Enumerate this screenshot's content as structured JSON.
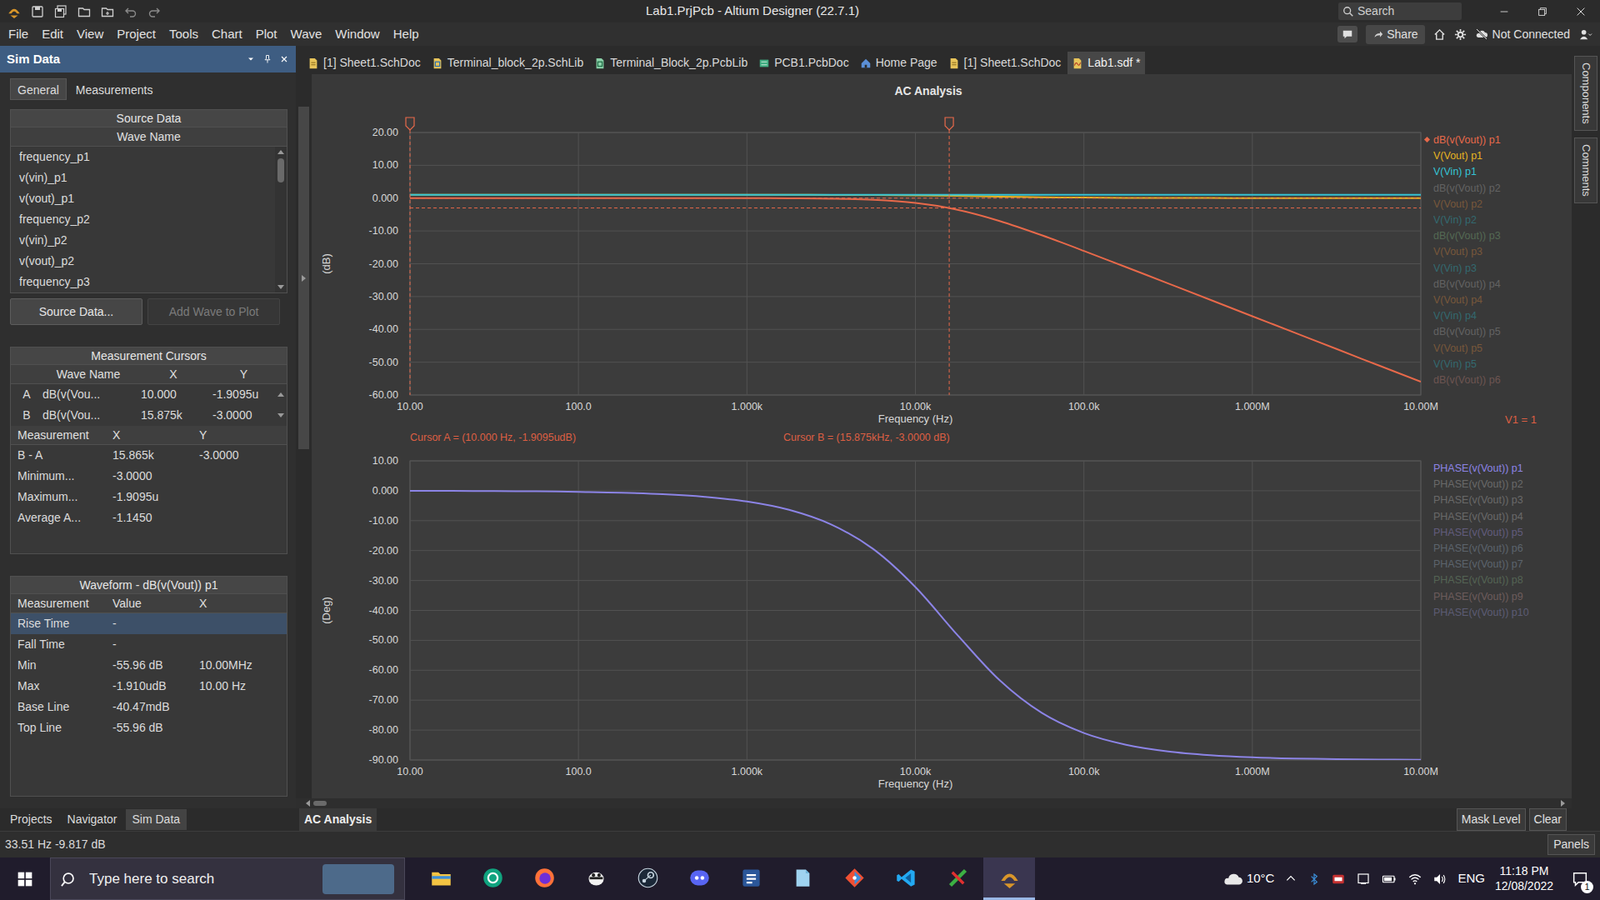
{
  "window": {
    "title": "Lab1.PrjPcb - Altium Designer (22.7.1)",
    "search_placeholder": "Search"
  },
  "menu": {
    "items": [
      "File",
      "Edit",
      "View",
      "Project",
      "Tools",
      "Chart",
      "Plot",
      "Wave",
      "Window",
      "Help"
    ],
    "share": "Share",
    "connection": "Not Connected"
  },
  "panel": {
    "title": "Sim Data",
    "tabs": [
      {
        "label": "General",
        "selected": true
      },
      {
        "label": "Measurements",
        "selected": false
      }
    ],
    "source": {
      "title": "Source Data",
      "column": "Wave Name",
      "items": [
        "frequency_p1",
        "v(vin)_p1",
        "v(vout)_p1",
        "frequency_p2",
        "v(vin)_p2",
        "v(vout)_p2",
        "frequency_p3"
      ],
      "scroll_level": 0.2
    },
    "buttons": [
      {
        "label": "Source Data...",
        "disabled": false
      },
      {
        "label": "Add Wave to Plot",
        "disabled": true
      }
    ],
    "cursors": {
      "title": "Measurement Cursors",
      "columns": [
        "Wave Name",
        "X",
        "Y"
      ],
      "rows": [
        {
          "id": "A",
          "cells": [
            "dB(v(Vou...",
            "10.000",
            "-1.9095u"
          ]
        },
        {
          "id": "B",
          "cells": [
            "dB(v(Vou...",
            "15.875k",
            "-3.0000"
          ]
        }
      ]
    },
    "measurements": {
      "columns": [
        "Measurement",
        "X",
        "Y"
      ],
      "rows": [
        [
          "B - A",
          "15.865k",
          "-3.0000"
        ],
        [
          "Minimum...",
          "-3.0000",
          ""
        ],
        [
          "Maximum...",
          "-1.9095u",
          ""
        ],
        [
          "Average A...",
          "-1.1450",
          ""
        ]
      ]
    },
    "waveform": {
      "title": "Waveform - dB(v(Vout)) p1",
      "columns": [
        "Measurement",
        "Value",
        "X"
      ],
      "rows": [
        {
          "cells": [
            "Rise Time",
            "-",
            ""
          ],
          "selected": true
        },
        {
          "cells": [
            "Fall Time",
            "-",
            ""
          ],
          "selected": false
        },
        {
          "cells": [
            "Min",
            "-55.96 dB",
            "10.00MHz"
          ],
          "selected": false
        },
        {
          "cells": [
            "Max",
            "-1.910udB",
            "10.00 Hz"
          ],
          "selected": false
        },
        {
          "cells": [
            "Base Line",
            "-40.47mdB",
            ""
          ],
          "selected": false
        },
        {
          "cells": [
            "Top Line",
            "-55.96 dB",
            ""
          ],
          "selected": false
        }
      ]
    },
    "bottom_tabs": [
      {
        "label": "Projects",
        "selected": false
      },
      {
        "label": "Navigator",
        "selected": false
      },
      {
        "label": "Sim Data",
        "selected": true
      }
    ]
  },
  "doc_tabs": [
    {
      "label": "[1] Sheet1.SchDoc",
      "kind": "sch",
      "selected": false
    },
    {
      "label": "Terminal_block_2p.SchLib",
      "kind": "schlib",
      "selected": false
    },
    {
      "label": "Terminal_Block_2p.PcbLib",
      "kind": "pcblib",
      "selected": false
    },
    {
      "label": "PCB1.PcbDoc",
      "kind": "pcb",
      "selected": false
    },
    {
      "label": "Home Page",
      "kind": "home",
      "selected": false
    },
    {
      "label": "[1] Sheet1.SchDoc",
      "kind": "sch",
      "selected": false
    },
    {
      "label": "Lab1.sdf *",
      "kind": "sdf",
      "selected": true
    }
  ],
  "chart": {
    "title": "AC Analysis",
    "frequencies": [
      10,
      17.78,
      31.62,
      56.23,
      100,
      177.8,
      316.2,
      562.3,
      1000,
      1778,
      3162,
      5623,
      10000,
      17783,
      31623,
      56234,
      100000,
      177828,
      316228,
      562341,
      1000000,
      1778279,
      3162278,
      5623413,
      10000000
    ],
    "top": {
      "y_label": "(dB)",
      "x_label": "Frequency (Hz)",
      "y_max": 20,
      "y_min": -60,
      "x_ticks": [
        "10.00",
        "100.0",
        "1.000k",
        "10.00k",
        "100.0k",
        "1.000M",
        "10.00M"
      ],
      "y_ticks": [
        "20.00",
        "10.00",
        "0.000",
        "-10.00",
        "-20.00",
        "-30.00",
        "-40.00",
        "-50.00",
        "-60.00"
      ],
      "note": "V1 = 1",
      "legend": [
        {
          "label": "dB(v(Vout)) p1",
          "color": "#e8694a",
          "dimmed": false,
          "selected": true,
          "values": [
            -1.9e-06,
            -5e-06,
            -1.7e-05,
            -5.4e-05,
            -0.00017,
            -0.00054,
            -0.0017,
            -0.0055,
            -0.017,
            -0.054,
            -0.169,
            -0.513,
            -1.451,
            -3.531,
            -6.962,
            -11.32,
            -16.09,
            -21.02,
            -26.0,
            -30.99,
            -35.99,
            -40.99,
            -45.99,
            -50.99,
            -55.96
          ]
        },
        {
          "label": "V(Vout) p1",
          "color": "#e6b422",
          "dimmed": false,
          "selected": false,
          "values": [
            1,
            1,
            1,
            1,
            1,
            1,
            1,
            0.999,
            0.998,
            0.994,
            0.981,
            0.943,
            0.846,
            0.666,
            0.449,
            0.272,
            0.157,
            0.089,
            0.05,
            0.028,
            0.016,
            0.0089,
            0.005,
            0.0028,
            0.0016
          ]
        },
        {
          "label": "V(Vin) p1",
          "color": "#35c3d4",
          "dimmed": false,
          "selected": false,
          "values": [
            1,
            1,
            1,
            1,
            1,
            1,
            1,
            1,
            1,
            1,
            1,
            1,
            1,
            1,
            1,
            1,
            1,
            1,
            1,
            1,
            1,
            1,
            1,
            1,
            1
          ]
        },
        {
          "label": "dB(v(Vout)) p2",
          "color": "#8c8c8c",
          "dimmed": true,
          "selected": false
        },
        {
          "label": "V(Vout) p2",
          "color": "#b5763c",
          "dimmed": true,
          "selected": false
        },
        {
          "label": "V(Vin) p2",
          "color": "#2f9aa5",
          "dimmed": true,
          "selected": false
        },
        {
          "label": "dB(v(Vout)) p3",
          "color": "#6f9a6f",
          "dimmed": true,
          "selected": false
        },
        {
          "label": "V(Vout) p3",
          "color": "#b5763c",
          "dimmed": true,
          "selected": false
        },
        {
          "label": "V(Vin) p3",
          "color": "#2f9aa5",
          "dimmed": true,
          "selected": false
        },
        {
          "label": "dB(v(Vout)) p4",
          "color": "#8c8c8c",
          "dimmed": true,
          "selected": false
        },
        {
          "label": "V(Vout) p4",
          "color": "#b5763c",
          "dimmed": true,
          "selected": false
        },
        {
          "label": "V(Vin) p4",
          "color": "#2f9aa5",
          "dimmed": true,
          "selected": false
        },
        {
          "label": "dB(v(Vout)) p5",
          "color": "#8c8c8c",
          "dimmed": true,
          "selected": false
        },
        {
          "label": "V(Vout) p5",
          "color": "#b5763c",
          "dimmed": true,
          "selected": false
        },
        {
          "label": "V(Vin) p5",
          "color": "#2f9aa5",
          "dimmed": true,
          "selected": false
        },
        {
          "label": "dB(v(Vout)) p6",
          "color": "#a0706a",
          "dimmed": true,
          "selected": false
        }
      ],
      "cursors": [
        {
          "x": 10,
          "y": -1.9095e-06,
          "label": "Cursor A = (10.000 Hz, -1.9095udB)"
        },
        {
          "x": 15875,
          "y": -3,
          "label": "Cursor B = (15.875kHz, -3.0000 dB)"
        }
      ]
    },
    "bottom": {
      "y_label": "(Deg)",
      "x_label": "Frequency (Hz)",
      "y_max": 10,
      "y_min": -90,
      "x_ticks": [
        "10.00",
        "100.0",
        "1.000k",
        "10.00k",
        "100.0k",
        "1.000M",
        "10.00M"
      ],
      "y_ticks": [
        "10.00",
        "0.000",
        "-10.00",
        "-20.00",
        "-30.00",
        "-40.00",
        "-50.00",
        "-60.00",
        "-70.00",
        "-80.00",
        "-90.00"
      ],
      "legend": [
        {
          "label": "PHASE(v(Vout)) p1",
          "color": "#8c84e6",
          "dimmed": false,
          "values": [
            -0.04,
            -0.06,
            -0.11,
            -0.2,
            -0.36,
            -0.64,
            -1.14,
            -2.03,
            -3.6,
            -6.39,
            -11.27,
            -19.5,
            -32.21,
            -48.25,
            -63.35,
            -74.24,
            -80.98,
            -84.9,
            -87.13,
            -88.38,
            -89.09,
            -89.49,
            -89.71,
            -89.84,
            -89.91
          ]
        },
        {
          "label": "PHASE(v(Vout)) p2",
          "color": "#9a9a9a",
          "dimmed": true
        },
        {
          "label": "PHASE(v(Vout)) p3",
          "color": "#9a9a9a",
          "dimmed": true
        },
        {
          "label": "PHASE(v(Vout)) p4",
          "color": "#9a9a9a",
          "dimmed": true
        },
        {
          "label": "PHASE(v(Vout)) p5",
          "color": "#8a7fbf",
          "dimmed": true
        },
        {
          "label": "PHASE(v(Vout)) p6",
          "color": "#7f8fa0",
          "dimmed": true
        },
        {
          "label": "PHASE(v(Vout)) p7",
          "color": "#7f8fa0",
          "dimmed": true
        },
        {
          "label": "PHASE(v(Vout)) p8",
          "color": "#6f8f6f",
          "dimmed": true
        },
        {
          "label": "PHASE(v(Vout)) p9",
          "color": "#a07f7f",
          "dimmed": true
        },
        {
          "label": "PHASE(v(Vout)) p10",
          "color": "#7f7faf",
          "dimmed": true
        }
      ]
    }
  },
  "chart_tabs": [
    {
      "label": "AC Analysis",
      "selected": true
    }
  ],
  "chart_buttons": [
    "Mask Level",
    "Clear"
  ],
  "side_panels": [
    "Components",
    "Comments"
  ],
  "status_bar": {
    "text": "33.51 Hz -9.817 dB",
    "button": "Panels"
  },
  "taskbar": {
    "search_placeholder": "Type here to search",
    "apps": [
      {
        "kind": "explorer",
        "active": false
      },
      {
        "kind": "chatgpt",
        "active": false
      },
      {
        "kind": "firefox",
        "active": false
      },
      {
        "kind": "bee",
        "active": false
      },
      {
        "kind": "steam",
        "active": false
      },
      {
        "kind": "discord",
        "active": false
      },
      {
        "kind": "word",
        "active": false
      },
      {
        "kind": "notes",
        "active": false
      },
      {
        "kind": "git",
        "active": false
      },
      {
        "kind": "vscode",
        "active": false
      },
      {
        "kind": "cad",
        "active": false
      },
      {
        "kind": "altium",
        "active": true
      }
    ],
    "weather": "10°C",
    "language": "ENG",
    "time": "11:18 PM",
    "date": "12/08/2022",
    "notifications": "1"
  }
}
